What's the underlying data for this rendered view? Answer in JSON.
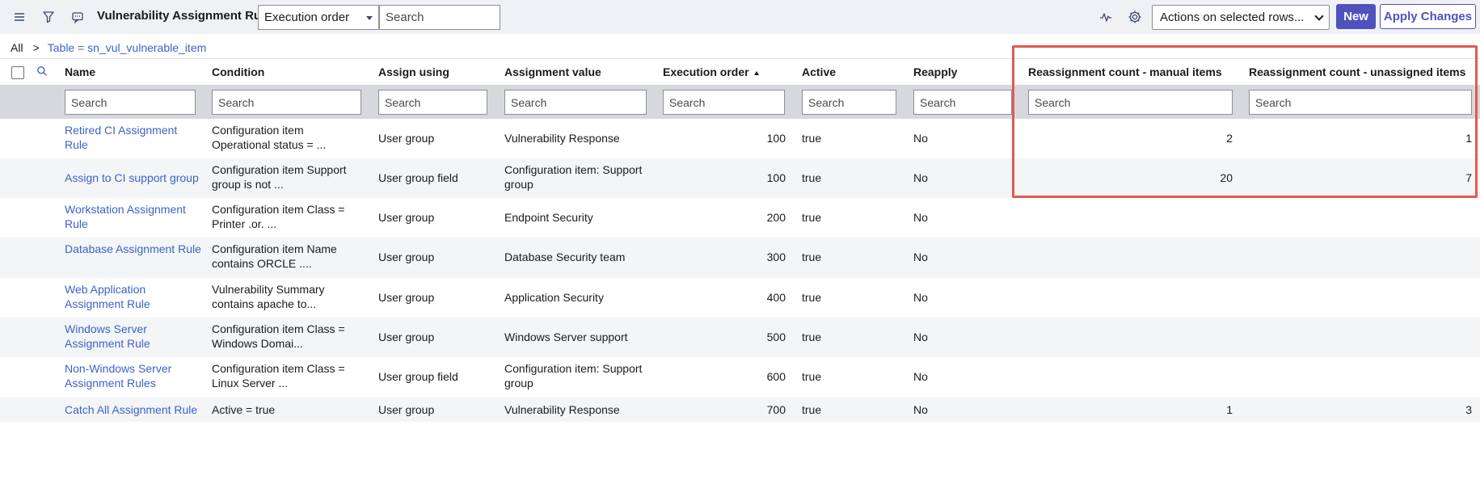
{
  "header": {
    "title": "Vulnerability Assignment Rules",
    "group_by": "Execution order",
    "search_placeholder": "Search",
    "actions_select": "Actions on selected rows...",
    "new_label": "New",
    "apply_label": "Apply Changes"
  },
  "icons": {
    "menu": "hamburger-menu-icon",
    "filter": "filter-icon",
    "comment": "comment-icon",
    "activity": "activity-pulse-icon",
    "settings": "gear-icon",
    "search": "search-icon"
  },
  "breadcrumb": {
    "all": "All",
    "separator": ">",
    "filter": "Table = sn_vul_vulnerable_item"
  },
  "columns": {
    "name": "Name",
    "condition": "Condition",
    "assign_using": "Assign using",
    "assignment_value": "Assignment value",
    "execution_order": "Execution order",
    "active": "Active",
    "reapply": "Reapply",
    "reassign_manual": "Reassignment count - manual items",
    "reassign_unassigned": "Reassignment count - unassigned items"
  },
  "column_search_placeholder": "Search",
  "rows": [
    {
      "name": "Retired CI Assignment Rule",
      "condition": "Configuration item Operational status = ...",
      "assign_using": "User group",
      "assignment_value": "Vulnerability Response",
      "execution_order": "100",
      "active": "true",
      "reapply": "No",
      "manual": "2",
      "unassigned": "1"
    },
    {
      "name": "Assign to CI support group",
      "condition": "Configuration item Support group is not ...",
      "assign_using": "User group field",
      "assignment_value": "Configuration item: Support group",
      "execution_order": "100",
      "active": "true",
      "reapply": "No",
      "manual": "20",
      "unassigned": "7"
    },
    {
      "name": "Workstation Assignment Rule",
      "condition": "Configuration item Class = Printer .or. ...",
      "assign_using": "User group",
      "assignment_value": "Endpoint Security",
      "execution_order": "200",
      "active": "true",
      "reapply": "No",
      "manual": "",
      "unassigned": ""
    },
    {
      "name": "Database Assignment Rule",
      "condition": "Configuration item Name contains ORCLE ....",
      "assign_using": "User group",
      "assignment_value": "Database Security team",
      "execution_order": "300",
      "active": "true",
      "reapply": "No",
      "manual": "",
      "unassigned": ""
    },
    {
      "name": "Web Application Assignment Rule",
      "condition": "Vulnerability Summary contains apache to...",
      "assign_using": "User group",
      "assignment_value": "Application Security",
      "execution_order": "400",
      "active": "true",
      "reapply": "No",
      "manual": "",
      "unassigned": ""
    },
    {
      "name": "Windows Server Assignment Rule",
      "condition": "Configuration item Class = Windows Domai...",
      "assign_using": "User group",
      "assignment_value": "Windows Server support",
      "execution_order": "500",
      "active": "true",
      "reapply": "No",
      "manual": "",
      "unassigned": ""
    },
    {
      "name": "Non-Windows Server Assignment Rules",
      "condition": "Configuration item Class = Linux Server ...",
      "assign_using": "User group field",
      "assignment_value": "Configuration item: Support group",
      "execution_order": "600",
      "active": "true",
      "reapply": "No",
      "manual": "",
      "unassigned": ""
    },
    {
      "name": "Catch All Assignment Rule",
      "condition": "Active = true",
      "assign_using": "User group",
      "assignment_value": "Vulnerability Response",
      "execution_order": "700",
      "active": "true",
      "reapply": "No",
      "manual": "1",
      "unassigned": "3"
    }
  ],
  "colors": {
    "primary": "#4f52bd",
    "link": "#3b63c9",
    "highlight_border": "#e05a52",
    "header_bg": "#eff1f4",
    "filter_row_bg": "#d6d8dd"
  }
}
